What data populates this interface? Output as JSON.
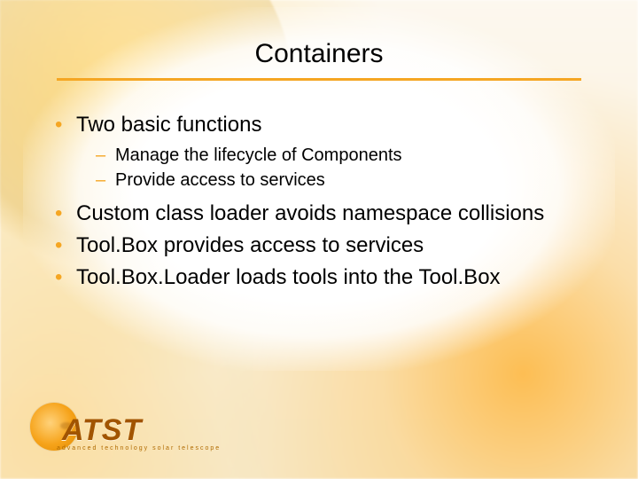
{
  "title": "Containers",
  "bullets": [
    {
      "text": "Two basic functions",
      "sub": [
        "Manage the lifecycle of Components",
        "Provide access to services"
      ]
    },
    {
      "text": "Custom class loader avoids namespace collisions"
    },
    {
      "text": "Tool.Box provides access to services"
    },
    {
      "text": "Tool.Box.Loader loads tools into the Tool.Box"
    }
  ],
  "logo": {
    "acronym": "ATST",
    "subtitle": "advanced  technology  solar  telescope"
  }
}
